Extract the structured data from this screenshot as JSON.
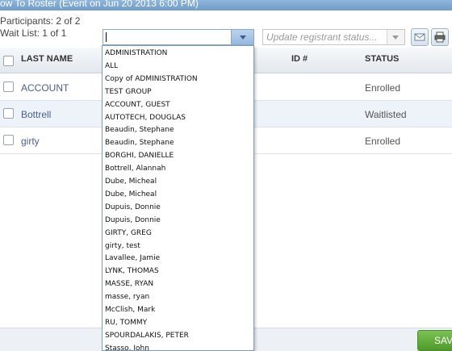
{
  "header": {
    "title": "ow To Roster (Event on Jun 20 2013 6:00 PM)"
  },
  "summary": {
    "participants": "Participants: 2 of 2",
    "waitlist": "Wait List: 1 of 1"
  },
  "toolbar": {
    "combo_value": "",
    "status_placeholder": "Update registrant status...",
    "email_icon": "email-icon",
    "print_icon": "print-icon"
  },
  "table": {
    "headers": {
      "last_name": "LAST NAME",
      "id": "ID #",
      "status": "STATUS"
    },
    "rows": [
      {
        "last_name": "ACCOUNT",
        "id": "",
        "status": "Enrolled"
      },
      {
        "last_name": "Bottrell",
        "id": "",
        "status": "Waitlisted"
      },
      {
        "last_name": "girty",
        "id": "",
        "status": "Enrolled"
      }
    ]
  },
  "dropdown": {
    "items": [
      "ADMINISTRATION",
      "ALL",
      "Copy of ADMINISTRATION",
      "TEST GROUP",
      "ACCOUNT, GUEST",
      "AUTOTECH, DOUGLAS",
      "Beaudin, Stephane",
      "Beaudin, Stephane",
      "BORGHI, DANIELLE",
      "Bottrell, Alannah",
      "Dube, Micheal",
      "Dube, Micheal",
      "Dupuis, Donnie",
      "Dupuis, Donnie",
      "GIRTY, GREG",
      "girty, test",
      "Lavallee, Jamie",
      "LYNK, THOMAS",
      "MASSE, RYAN",
      "masse, ryan",
      "McClish, Mark",
      "RU, TOMMY",
      "SPOURDALAKIS, PETER",
      "Stasso, John"
    ]
  },
  "footer": {
    "save_label": "SAVE"
  },
  "colors": {
    "accent": "#6f9cc9",
    "save": "#5aa532",
    "link": "#4b5f8a"
  }
}
